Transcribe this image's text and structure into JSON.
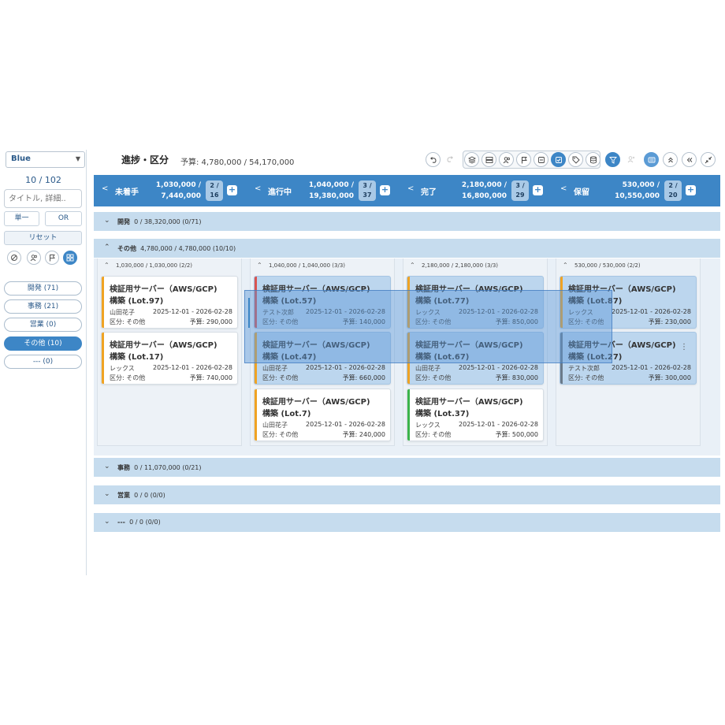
{
  "sidebar": {
    "theme": "Blue",
    "count": "10 / 102",
    "search_placeholder": "タイトル, 詳細..",
    "single_label": "単一",
    "or_label": "OR",
    "reset_label": "リセット",
    "filters": [
      {
        "label": "開発 (71)",
        "active": false
      },
      {
        "label": "事務 (21)",
        "active": false
      },
      {
        "label": "営業 (0)",
        "active": false
      },
      {
        "label": "その他 (10)",
        "active": true
      },
      {
        "label": "--- (0)",
        "active": false
      }
    ]
  },
  "header": {
    "title": "進捗・区分",
    "budget": "予算: 4,780,000 / 54,170,000"
  },
  "columns": [
    {
      "name": "未着手",
      "line1": "1,030,000 /",
      "line2": "7,440,000",
      "badge_top": "2 /",
      "badge_bottom": "16"
    },
    {
      "name": "進行中",
      "line1": "1,040,000 /",
      "line2": "19,380,000",
      "badge_top": "3 /",
      "badge_bottom": "37"
    },
    {
      "name": "完了",
      "line1": "2,180,000 /",
      "line2": "16,800,000",
      "badge_top": "3 /",
      "badge_bottom": "29"
    },
    {
      "name": "保留",
      "line1": "530,000 /",
      "line2": "10,550,000",
      "badge_top": "2 /",
      "badge_bottom": "20"
    }
  ],
  "groups": {
    "dev": {
      "name": "開発",
      "stats": "0 / 38,320,000  (0/71)"
    },
    "other": {
      "name": "その他",
      "stats": "4,780,000 / 4,780,000  (10/10)"
    },
    "office": {
      "name": "事務",
      "stats": "0 / 11,070,000  (0/21)"
    },
    "sales": {
      "name": "営業",
      "stats": "0 / 0  (0/0)"
    },
    "none": {
      "name": "---",
      "stats": "0 / 0  (0/0)"
    }
  },
  "lanes": [
    {
      "summary": "1,030,000 / 1,030,000  (2/2)"
    },
    {
      "summary": "1,040,000 / 1,040,000  (3/3)"
    },
    {
      "summary": "2,180,000 / 2,180,000  (3/3)"
    },
    {
      "summary": "530,000 / 530,000  (2/2)"
    }
  ],
  "cards": {
    "c1": {
      "title": "検証用サーバー（AWS/GCP)",
      "sub": "構築 (Lot.97)",
      "who": "山田花子",
      "date": "2025-12-01 - 2026-02-28",
      "cat": "区分: その他",
      "budget": "予算: 290,000"
    },
    "c2": {
      "title": "検証用サーバー（AWS/GCP)",
      "sub": "構築 (Lot.17)",
      "who": "レックス",
      "date": "2025-12-01 - 2026-02-28",
      "cat": "区分: その他",
      "budget": "予算: 740,000"
    },
    "c3": {
      "title": "検証用サーバー（AWS/GCP)",
      "sub": "構築 (Lot.57)",
      "who": "テスト次郎",
      "date": "2025-12-01 - 2026-02-28",
      "cat": "区分: その他",
      "budget": "予算: 140,000"
    },
    "c4": {
      "title": "検証用サーバー（AWS/GCP)",
      "sub": "構築 (Lot.47)",
      "who": "山田花子",
      "date": "2025-12-01 - 2026-02-28",
      "cat": "区分: その他",
      "budget": "予算: 660,000"
    },
    "c5": {
      "title": "検証用サーバー（AWS/GCP)",
      "sub": "構築 (Lot.7)",
      "who": "山田花子",
      "date": "2025-12-01 - 2026-02-28",
      "cat": "区分: その他",
      "budget": "予算: 240,000"
    },
    "c6": {
      "title": "検証用サーバー（AWS/GCP)",
      "sub": "構築 (Lot.77)",
      "who": "レックス",
      "date": "2025-12-01 - 2026-02-28",
      "cat": "区分: その他",
      "budget": "予算: 850,000"
    },
    "c7": {
      "title": "検証用サーバー（AWS/GCP)",
      "sub": "構築 (Lot.67)",
      "who": "山田花子",
      "date": "2025-12-01 - 2026-02-28",
      "cat": "区分: その他",
      "budget": "予算: 830,000"
    },
    "c8": {
      "title": "検証用サーバー（AWS/GCP)",
      "sub": "構築 (Lot.37)",
      "who": "レックス",
      "date": "2025-12-01 - 2026-02-28",
      "cat": "区分: その他",
      "budget": "予算: 500,000"
    },
    "c9": {
      "title": "検証用サーバー（AWS/GCP)",
      "sub": "構築 (Lot.87)",
      "who": "レックス",
      "date": "2025-12-01 - 2026-02-28",
      "cat": "区分: その他",
      "budget": "予算: 230,000"
    },
    "c10": {
      "title": "検証用サーバー（AWS/GCP)",
      "sub": "構築 (Lot.27)",
      "who": "テスト次郎",
      "date": "2025-12-01 - 2026-02-28",
      "cat": "区分: その他",
      "budget": "予算: 300,000"
    }
  },
  "colors": {
    "accent": "#3d86c6",
    "stripe_orange": "#f0a323",
    "stripe_red": "#d9534f",
    "stripe_green": "#3cb44b",
    "stripe_gray": "#6b7a89"
  }
}
